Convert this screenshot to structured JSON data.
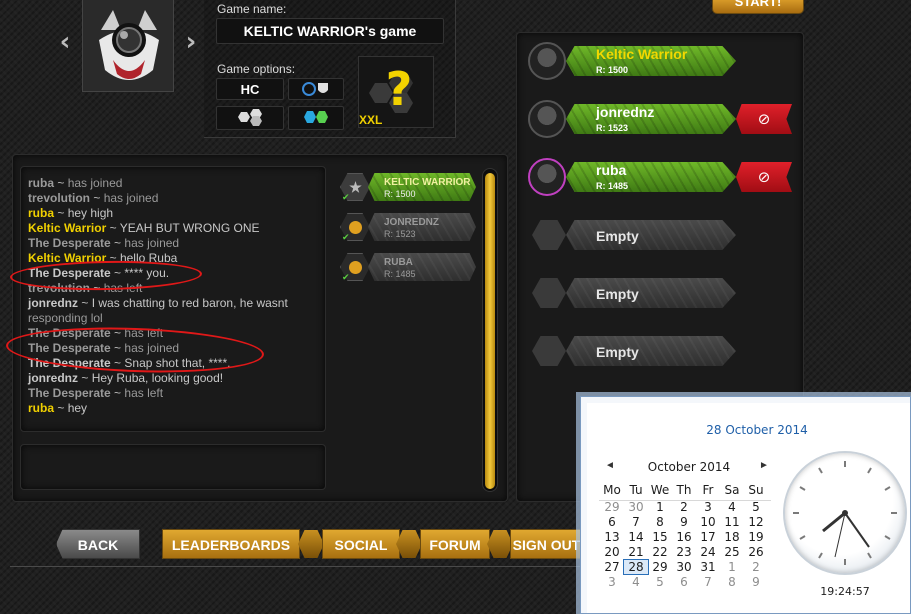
{
  "header": {
    "game_name_label": "Game name:",
    "game_name": "KELTIC WARRIOR's game",
    "game_options_label": "Game options:",
    "mode": "HC",
    "map_size": "XXL",
    "start_button": "START!",
    "prev_arrow": "‹",
    "next_arrow": "›"
  },
  "chat": {
    "lines": [
      {
        "name": "ruba",
        "sep": " ~ ",
        "text": "has joined",
        "style": "system"
      },
      {
        "name": "trevolution",
        "sep": " ~ ",
        "text": "has joined",
        "style": "system"
      },
      {
        "name": "ruba",
        "sep": " ~ ",
        "text": "hey high",
        "style": "chat"
      },
      {
        "name": "Keltic Warrior",
        "sep": " ~ ",
        "text": "YEAH BUT WRONG ONE",
        "style": "chat"
      },
      {
        "name": "The Desperate",
        "sep": " ~ ",
        "text": "has joined",
        "style": "system"
      },
      {
        "name": "Keltic Warrior",
        "sep": " ~ ",
        "text": "hello Ruba",
        "style": "chat"
      },
      {
        "name": "The Desperate",
        "sep": " ~ ",
        "text": "**** you.",
        "style": "chat2"
      },
      {
        "name": "trevolution",
        "sep": " ~ ",
        "text": "has left",
        "style": "system"
      },
      {
        "name": "jonrednz",
        "sep": " ~ ",
        "text": "I was chatting to red baron, he wasnt",
        "style": "chat2"
      },
      {
        "name": "",
        "sep": "",
        "text": "responding lol",
        "style": "system"
      },
      {
        "name": "The Desperate",
        "sep": " ~ ",
        "text": "has left",
        "style": "system"
      },
      {
        "name": "The Desperate",
        "sep": " ~ ",
        "text": "has joined",
        "style": "system"
      },
      {
        "name": "The Desperate",
        "sep": " ~ ",
        "text": "Snap shot that, ****.",
        "style": "chat2"
      },
      {
        "name": "jonrednz",
        "sep": " ~ ",
        "text": "Hey Ruba, looking good!",
        "style": "chat2"
      },
      {
        "name": "The Desperate",
        "sep": " ~ ",
        "text": "has left",
        "style": "system"
      },
      {
        "name": "ruba",
        "sep": " ~ ",
        "text": "hey",
        "style": "chat"
      }
    ]
  },
  "players": [
    {
      "name": "KELTIC WARRIOR",
      "rating": "R: 1500"
    },
    {
      "name": "JONREDNZ",
      "rating": "R: 1523"
    },
    {
      "name": "RUBA",
      "rating": "R: 1485"
    }
  ],
  "slots": [
    {
      "name": "Keltic Warrior",
      "rating": "R: 1500",
      "host": true
    },
    {
      "name": "jonrednz",
      "rating": "R: 1523",
      "host": false
    },
    {
      "name": "ruba",
      "rating": "R: 1485",
      "host": false
    },
    {
      "name": "Empty"
    },
    {
      "name": "Empty"
    },
    {
      "name": "Empty"
    }
  ],
  "nav": {
    "back": "BACK",
    "leaderboards": "LEADERBOARDS",
    "social": "SOCIAL",
    "forum": "FORUM",
    "sign_out": "SIGN OUT"
  },
  "calendar": {
    "date_header": "28 October 2014",
    "month_label": "October 2014",
    "prev": "◄",
    "next": "►",
    "weekdays": [
      "Mo",
      "Tu",
      "We",
      "Th",
      "Fr",
      "Sa",
      "Su"
    ],
    "weeks": [
      [
        "29",
        "30",
        "1",
        "2",
        "3",
        "4",
        "5"
      ],
      [
        "6",
        "7",
        "8",
        "9",
        "10",
        "11",
        "12"
      ],
      [
        "13",
        "14",
        "15",
        "16",
        "17",
        "18",
        "19"
      ],
      [
        "20",
        "21",
        "22",
        "23",
        "24",
        "25",
        "26"
      ],
      [
        "27",
        "28",
        "29",
        "30",
        "31",
        "1",
        "2"
      ],
      [
        "3",
        "4",
        "5",
        "6",
        "7",
        "8",
        "9"
      ]
    ],
    "today": "28",
    "time": "19:24:57"
  },
  "colors": {
    "accent_gold": "#f0d000",
    "green_bar": "#5aa020",
    "kick_red": "#d0161f",
    "marker_red": "#e01818"
  }
}
